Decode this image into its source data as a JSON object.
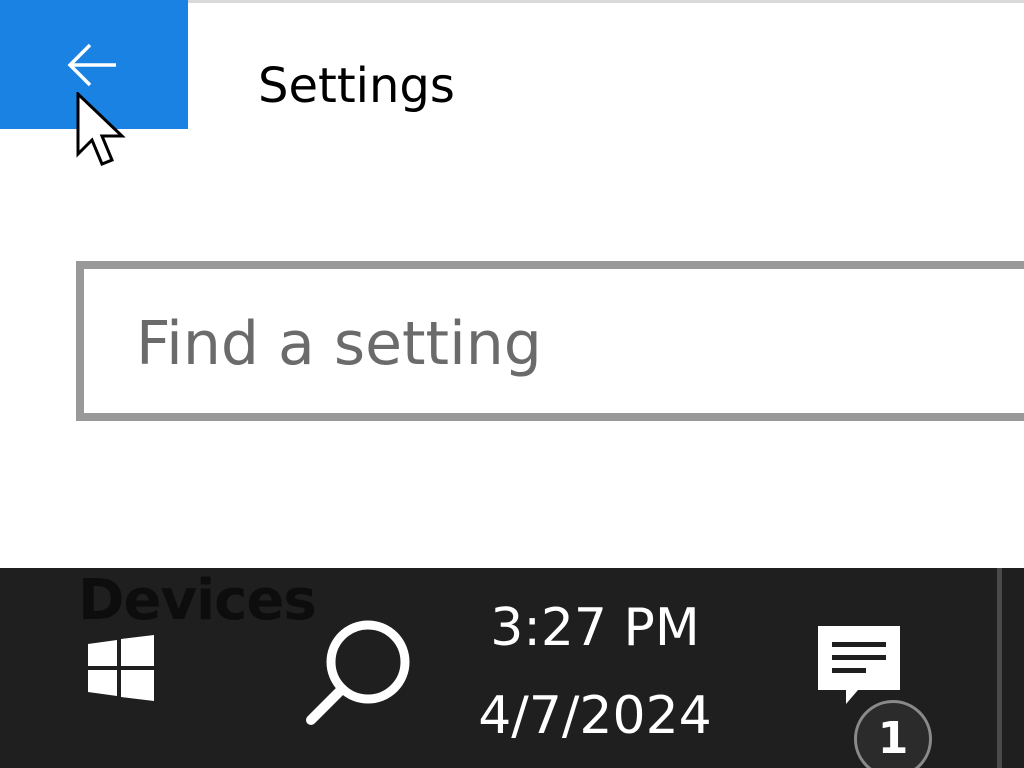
{
  "window": {
    "title": "Settings",
    "back_button": {
      "icon": "arrow-left-icon",
      "color": "#1a82e2"
    },
    "search": {
      "placeholder": "Find a setting",
      "value": ""
    }
  },
  "taskbar": {
    "overlay_label": "Devices",
    "start_icon": "windows-logo-icon",
    "search_icon": "search-icon",
    "clock": {
      "time": "3:27 PM",
      "date": "4/7/2024"
    },
    "action_center": {
      "icon": "message-icon",
      "badge_count": "1"
    },
    "background": "#1f1f1f"
  }
}
